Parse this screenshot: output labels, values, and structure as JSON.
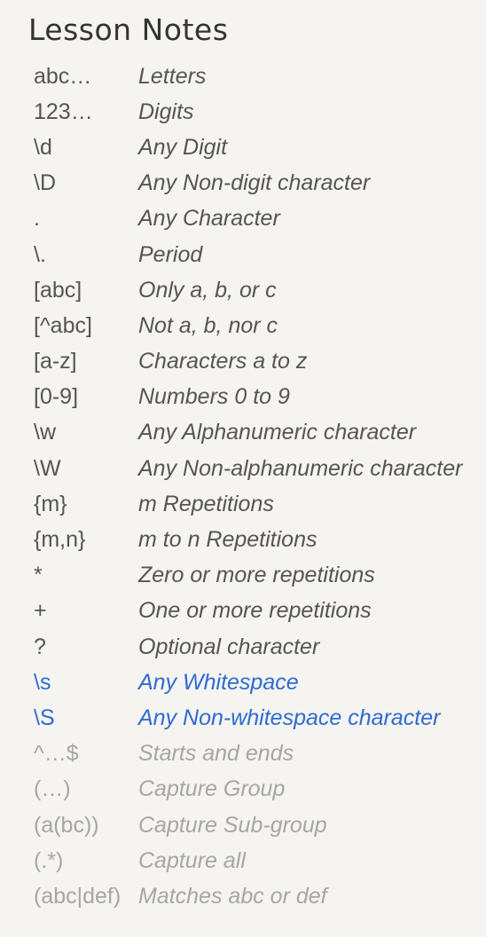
{
  "title": "Lesson Notes",
  "notes": [
    {
      "symbol": "abc…",
      "description": "Letters",
      "state": "done"
    },
    {
      "symbol": "123…",
      "description": "Digits",
      "state": "done"
    },
    {
      "symbol": "\\d",
      "description": "Any Digit",
      "state": "done"
    },
    {
      "symbol": "\\D",
      "description": "Any Non-digit character",
      "state": "done"
    },
    {
      "symbol": ".",
      "description": "Any Character",
      "state": "done"
    },
    {
      "symbol": "\\.",
      "description": "Period",
      "state": "done"
    },
    {
      "symbol": "[abc]",
      "description": "Only a, b, or c",
      "state": "done"
    },
    {
      "symbol": "[^abc]",
      "description": "Not a, b, nor c",
      "state": "done"
    },
    {
      "symbol": "[a-z]",
      "description": "Characters a to z",
      "state": "done"
    },
    {
      "symbol": "[0-9]",
      "description": "Numbers 0 to 9",
      "state": "done"
    },
    {
      "symbol": "\\w",
      "description": "Any Alphanumeric character",
      "state": "done"
    },
    {
      "symbol": "\\W",
      "description": "Any Non-alphanumeric character",
      "state": "done"
    },
    {
      "symbol": "{m}",
      "description": "m Repetitions",
      "state": "done"
    },
    {
      "symbol": "{m,n}",
      "description": "m to n Repetitions",
      "state": "done"
    },
    {
      "symbol": "*",
      "description": "Zero or more repetitions",
      "state": "done"
    },
    {
      "symbol": "+",
      "description": "One or more repetitions",
      "state": "done"
    },
    {
      "symbol": "?",
      "description": "Optional character",
      "state": "done"
    },
    {
      "symbol": "\\s",
      "description": "Any Whitespace",
      "state": "active"
    },
    {
      "symbol": "\\S",
      "description": "Any Non-whitespace character",
      "state": "active"
    },
    {
      "symbol": "^…$",
      "description": "Starts and ends",
      "state": "future"
    },
    {
      "symbol": "(…)",
      "description": "Capture Group",
      "state": "future"
    },
    {
      "symbol": "(a(bc))",
      "description": "Capture Sub-group",
      "state": "future"
    },
    {
      "symbol": "(.*)",
      "description": "Capture all",
      "state": "future"
    },
    {
      "symbol": "(abc|def)",
      "description": "Matches abc or def",
      "state": "future"
    }
  ],
  "colors": {
    "background": "#f5f4f1",
    "text": "#555555",
    "active": "#2f6bd0",
    "future": "#a6a6a6"
  }
}
